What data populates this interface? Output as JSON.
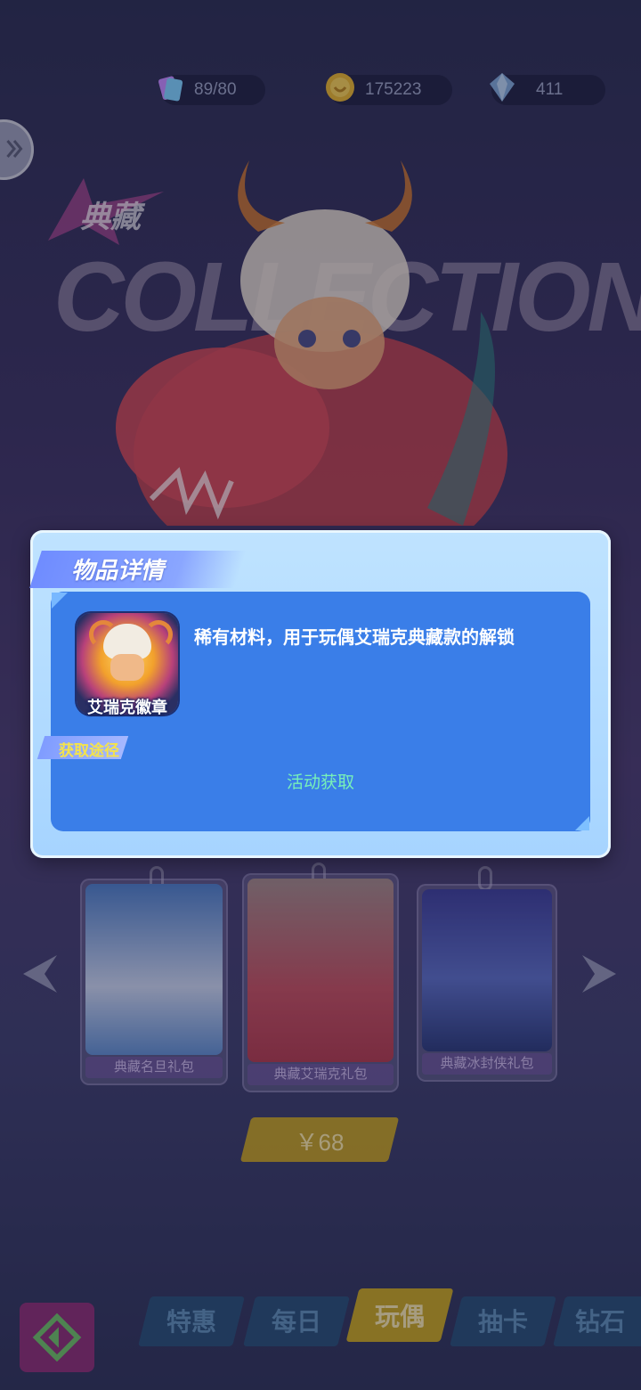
{
  "top_bar": {
    "energy": "89/80",
    "coins": "175223",
    "gems": "411"
  },
  "hero": {
    "badge_text": "典藏",
    "title_art": "COLLECTION"
  },
  "dialog": {
    "title": "物品详情",
    "item_name": "艾瑞克徽章",
    "description": "稀有材料，用于玩偶艾瑞克典藏款的解锁",
    "source_label": "获取途径",
    "source_value": "活动获取"
  },
  "cards": [
    {
      "label": "典藏名旦礼包"
    },
    {
      "label": "典藏艾瑞克礼包"
    },
    {
      "label": "典藏冰封侠礼包"
    }
  ],
  "price": "￥68",
  "tabs": [
    "特惠",
    "每日",
    "玩偶",
    "抽卡",
    "钻石"
  ],
  "colors": {
    "dialog_body": "#3a7ee8",
    "source_value": "#78f0b8",
    "source_label": "#f5e34a",
    "active_tab": "#d8b21c"
  }
}
